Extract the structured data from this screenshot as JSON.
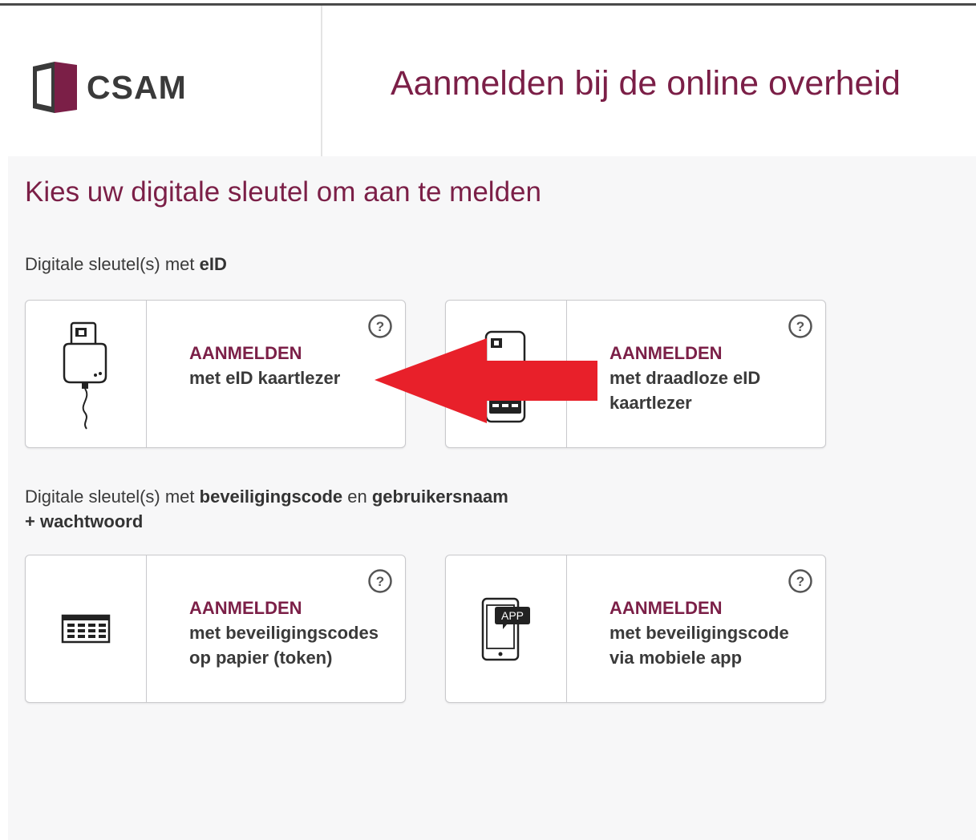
{
  "header": {
    "logo_text": "CSAM",
    "title": "Aanmelden bij de online overheid"
  },
  "main": {
    "heading": "Kies uw digitale sleutel om aan te melden",
    "sections": [
      {
        "label_prefix": "Digitale sleutel(s) met ",
        "label_bold": "eID",
        "cards": [
          {
            "kicker": "AANMELDEN",
            "description": "met eID kaartlezer",
            "icon": "card-reader-icon"
          },
          {
            "kicker": "AANMELDEN",
            "description": "met draadloze eID kaartlezer",
            "icon": "wireless-card-reader-icon"
          }
        ]
      },
      {
        "label_prefix": "Digitale sleutel(s) met ",
        "label_bold": "beveiligingscode",
        "label_mid": " en ",
        "label_bold2": "gebruikersnaam",
        "label_line2": "+ wachtwoord",
        "cards": [
          {
            "kicker": "AANMELDEN",
            "description": "met beveiligingscodes op papier (token)",
            "icon": "token-card-icon"
          },
          {
            "kicker": "AANMELDEN",
            "description": "met beveiligingscode via mobiele app",
            "icon": "mobile-app-icon",
            "badge": "APP"
          }
        ]
      }
    ]
  },
  "annotation": {
    "arrow_color": "#e8202a"
  },
  "colors": {
    "brand": "#7b1f47",
    "text": "#3a3a3a",
    "panel": "#f7f7f8"
  }
}
